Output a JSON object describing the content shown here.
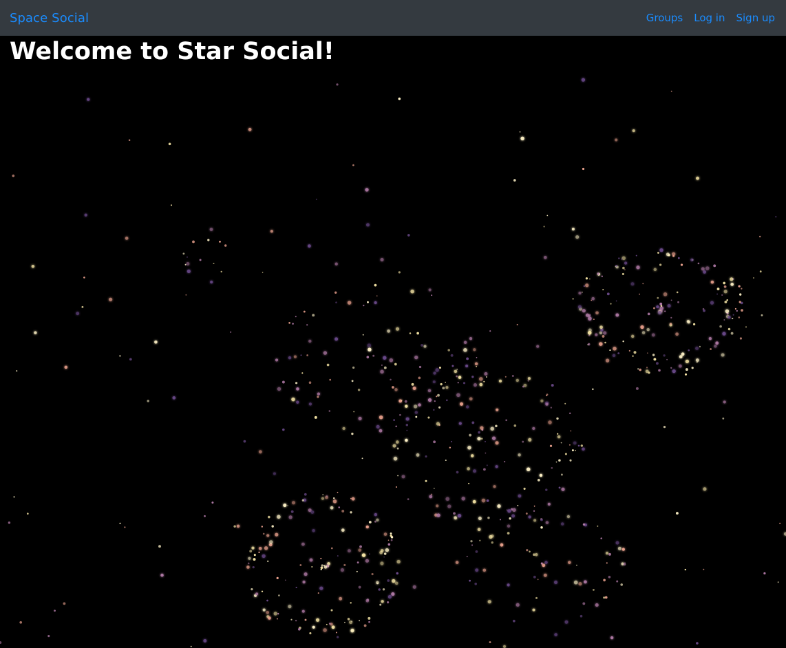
{
  "navbar": {
    "brand": "Space Social",
    "links": [
      {
        "label": "Groups"
      },
      {
        "label": "Log in"
      },
      {
        "label": "Sign up"
      }
    ]
  },
  "main": {
    "title": "Welcome to Star Social!"
  },
  "colors": {
    "navbar_bg": "#343a40",
    "link": "#1a8cff",
    "background": "#000000",
    "title": "#ffffff",
    "star_palette": [
      "#fff3c8",
      "#e8a08c",
      "#b07aa6",
      "#6b4a8a",
      "#f7e6a6"
    ]
  }
}
